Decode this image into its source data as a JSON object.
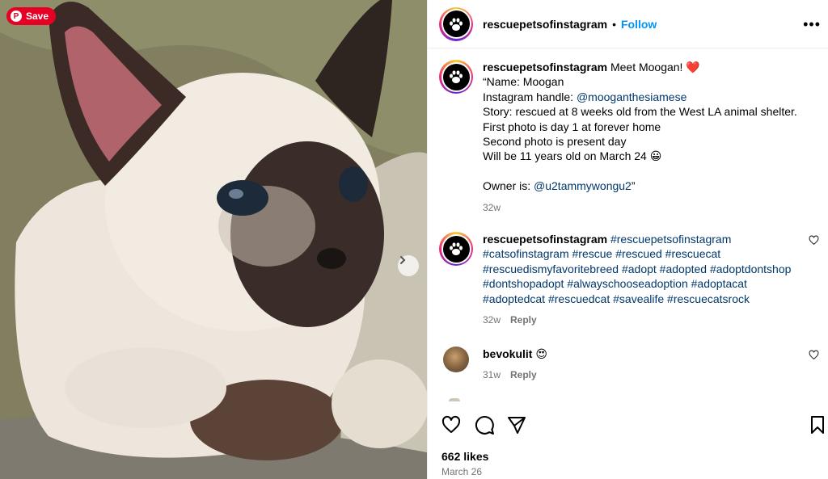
{
  "media": {
    "save_label": "Save"
  },
  "header": {
    "username": "rescuepetsofinstagram",
    "separator": "•",
    "follow_label": "Follow",
    "more_label": "•••"
  },
  "caption": {
    "username": "rescuepetsofinstagram",
    "title": "Meet Moogan! ❤️",
    "line_name": "“Name: Moogan",
    "handle_prefix": "Instagram handle: ",
    "handle_link": "@mooganthesiamese",
    "line_story": "Story: rescued at 8 weeks old from the West LA animal shelter.",
    "line_first": "First photo is day 1 at forever home",
    "line_second": "Second photo is present day",
    "line_birthday": "Will be 11 years old on March 24 😀",
    "owner_prefix": "Owner is: ",
    "owner_link": "@u2tammywongu2",
    "owner_suffix": "”",
    "time": "32w"
  },
  "comments": [
    {
      "username": "rescuepetsofinstagram",
      "hashtags": "#rescuepetsofinstagram #catsofinstagram #rescue #rescued #rescuecat #rescuedismyfavoritebreed #adopt #adopted #adoptdontshop #dontshopadopt #alwayschooseadoption #adoptacat #adoptedcat #rescuedcat #savealife #rescuecatsrock",
      "time": "32w",
      "reply": "Reply"
    },
    {
      "username": "bevokulit",
      "text": "😍",
      "time": "31w",
      "reply": "Reply"
    }
  ],
  "stats": {
    "likes": "662 likes",
    "date": "March 26"
  },
  "colors": {
    "accent": "#0095f6",
    "link": "#00376b",
    "pinterest": "#e60023",
    "muted": "#737373"
  }
}
